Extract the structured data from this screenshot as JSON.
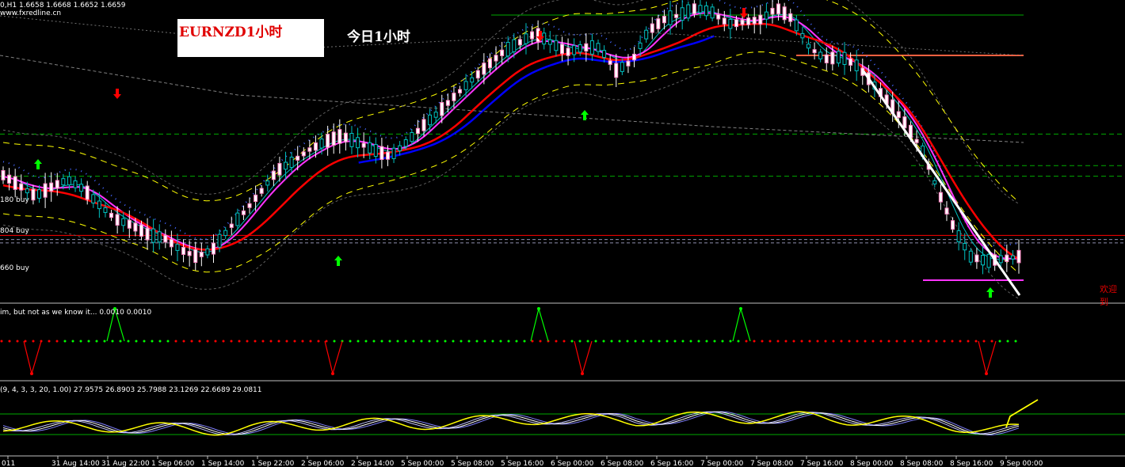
{
  "header": {
    "ohlc": "0,H1  1.6658 1.6668 1.6652 1.6659",
    "site": "www.fxredline.cn"
  },
  "annotations": {
    "label_red": "EURNZD1小时",
    "label_white": "今日1小时",
    "welcome": "欢迎到"
  },
  "levels": [
    {
      "label": "180 buy",
      "price": 1.678
    },
    {
      "label": "804 buy",
      "price": 1.673
    },
    {
      "label": "660 buy",
      "price": 1.666
    }
  ],
  "indicators": {
    "zigzag_label": "im, but not as we know it... 0.0010 0.0010",
    "stoch_label": "(9, 4, 3, 3, 20, 1.00) 27.9575 26.8903 25.7988 23.1269 22.6689 29.0811"
  },
  "colors": {
    "background": "#000000",
    "bull": "#00ff00",
    "bear": "#ff0000",
    "ma_fast": "#ff33ff",
    "ma_slow_red": "#ff0000",
    "ma_blue": "#0000ff",
    "band": "#ffff00",
    "level": "#00aa00",
    "grid": "#c0c0c0"
  },
  "chart_data": {
    "type": "line",
    "symbol": "EURNZD",
    "timeframe": "H1",
    "x_ticks": [
      "011",
      "31 Aug 14:00",
      "31 Aug 22:00",
      "1 Sep 06:00",
      "1 Sep 14:00",
      "1 Sep 22:00",
      "2 Sep 06:00",
      "2 Sep 14:00",
      "5 Sep 00:00",
      "5 Sep 08:00",
      "5 Sep 16:00",
      "6 Sep 00:00",
      "6 Sep 08:00",
      "6 Sep 16:00",
      "7 Sep 00:00",
      "7 Sep 08:00",
      "7 Sep 16:00",
      "8 Sep 00:00",
      "8 Sep 08:00",
      "8 Sep 16:00",
      "9 Sep 00:00"
    ],
    "price_path": [
      0.76,
      0.67,
      0.58,
      0.66,
      0.72,
      0.64,
      0.5,
      0.38,
      0.33,
      0.25,
      0.22,
      0.12,
      0.06,
      0.12,
      0.3,
      0.45,
      0.62,
      0.8,
      0.88,
      0.98,
      1.05,
      1.1,
      1.04,
      0.98,
      0.92,
      1.04,
      1.18,
      1.3,
      1.44,
      1.57,
      1.7,
      1.82,
      1.9,
      1.98,
      1.9,
      1.82,
      1.86,
      1.86,
      1.66,
      1.74,
      2.0,
      2.1,
      2.14,
      2.2,
      2.16,
      2.06,
      2.08,
      2.1,
      2.2,
      2.1,
      1.86,
      1.76,
      1.78,
      1.7,
      1.54,
      1.38,
      1.2,
      0.98,
      0.62,
      0.3,
      0.06,
      0.02,
      0.04,
      0.06
    ],
    "price_range": [
      1.662,
      1.692
    ],
    "stoch_range": [
      0,
      100
    ],
    "zigzag_states": [
      "red",
      "red",
      "red",
      "red",
      "green",
      "green",
      "green",
      "green",
      "green",
      "green",
      "red",
      "red",
      "red",
      "red",
      "red",
      "red",
      "red",
      "red",
      "red",
      "green",
      "green",
      "green",
      "green",
      "green",
      "green",
      "green",
      "green",
      "green",
      "green",
      "green",
      "red",
      "red",
      "green",
      "green",
      "green",
      "green",
      "green",
      "green",
      "green",
      "green",
      "green",
      "green",
      "red",
      "red",
      "red",
      "red",
      "red",
      "red",
      "red",
      "red",
      "red",
      "red",
      "red",
      "red",
      "red",
      "red",
      "green",
      "green"
    ]
  }
}
